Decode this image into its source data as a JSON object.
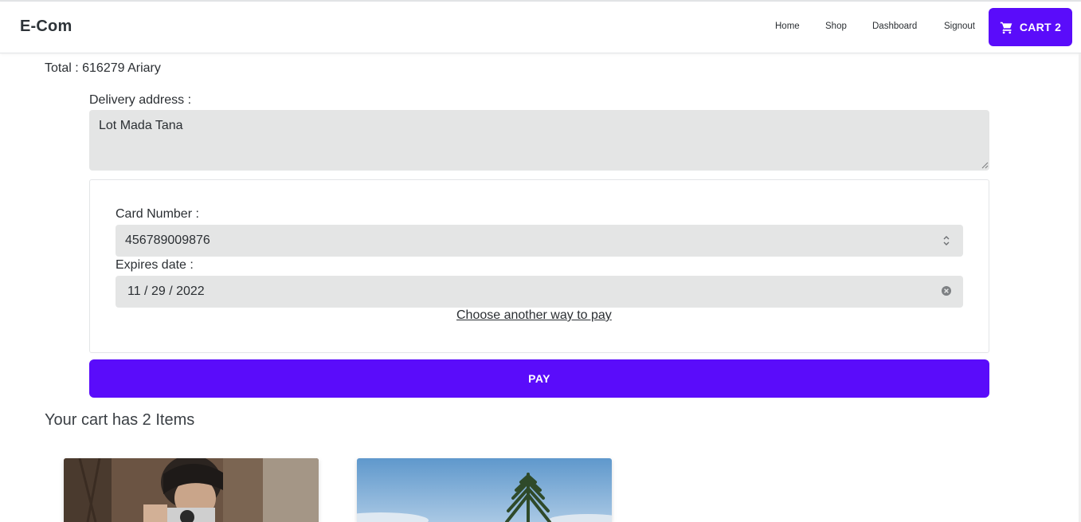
{
  "app": {
    "brand": "E-Com"
  },
  "nav": {
    "links": [
      "Home",
      "Shop",
      "Dashboard",
      "Signout"
    ],
    "cart_label": "CART 2",
    "cart_icon": "shopping-cart-icon"
  },
  "checkout": {
    "total_text": "Total : 616279 Ariary",
    "delivery_label": "Delivery address :",
    "delivery_value": "Lot Mada Tana",
    "card_number_label": "Card Number :",
    "card_number_value": "456789009876",
    "expires_label": "Expires date :",
    "expires_value": "11 / 29 / 2022",
    "other_pay_link": "Choose another way to pay",
    "pay_button": "PAY"
  },
  "cart": {
    "count_text": "Your cart has 2 Items",
    "items": [
      {
        "image": "man-with-camera-photo"
      },
      {
        "image": "palm-tree-sky-photo"
      }
    ]
  },
  "colors": {
    "accent": "#5a0cfa",
    "field_bg": "#e4e5e5",
    "text": "#2b2f33"
  }
}
